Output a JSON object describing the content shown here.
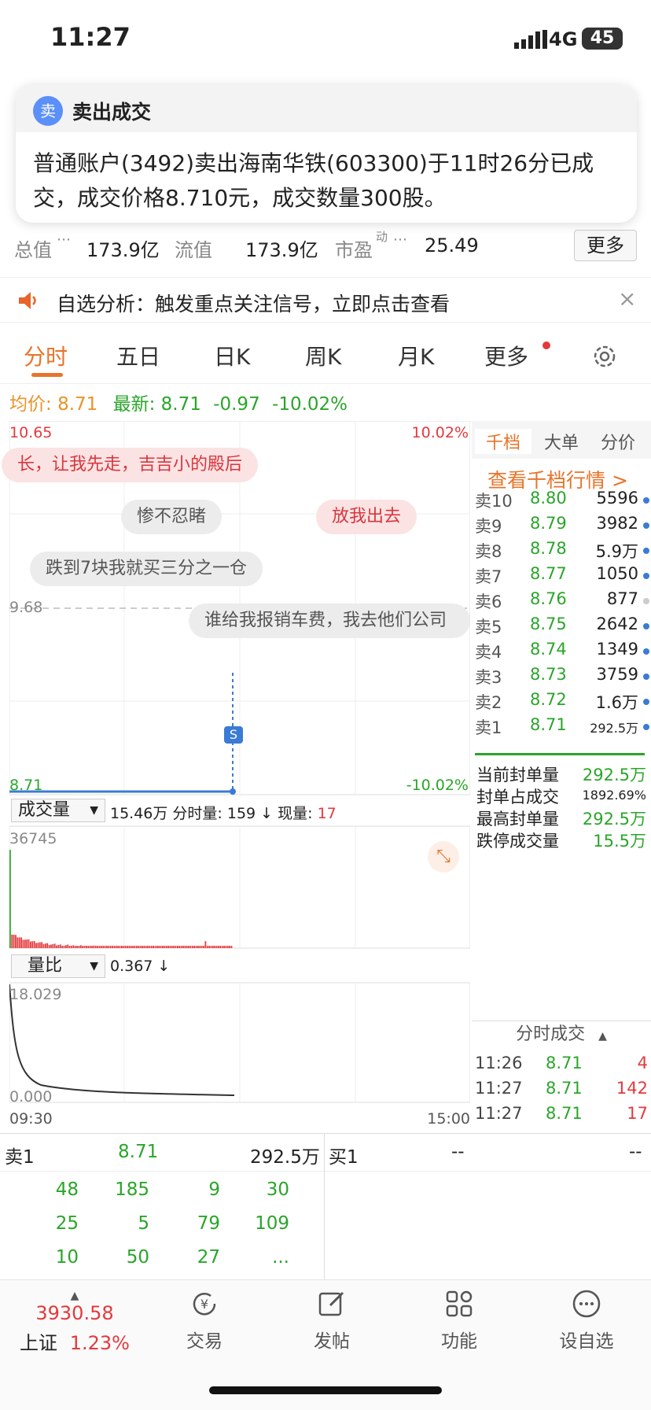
{
  "status_bar": {
    "time": "11:27",
    "network": "4G",
    "battery": "45"
  },
  "notification": {
    "icon_char": "卖",
    "title": "卖出成交",
    "body": "普通账户(3492)卖出海南华铁(603300)于11时26分已成交，成交价格8.710元，成交数量300股。"
  },
  "stats": {
    "total_value_label": "总值",
    "total_value": "173.9亿",
    "float_value_label": "流值",
    "float_value": "173.9亿",
    "pe_label": "市盈",
    "pe_sup": "动",
    "pe_value": "25.49",
    "more_label": "更多"
  },
  "banner": {
    "text": "自选分析：触发重点关注信号，立即点击查看",
    "close": "×"
  },
  "tabs": [
    "分时",
    "五日",
    "日K",
    "周K",
    "月K",
    "更多"
  ],
  "quote_line": {
    "avg_label": "均价:",
    "avg_value": "8.71",
    "latest_label": "最新:",
    "latest_value": "8.71",
    "change": "-0.97",
    "change_pct": "-10.02%"
  },
  "chart": {
    "top_price": "10.65",
    "top_pct": "10.02%",
    "mid_price": "9.68",
    "bottom_price": "8.71",
    "bottom_pct": "-10.02%",
    "marker": "S",
    "bubbles": [
      "长，让我先走，吉吉小的殿后",
      "惨不忍睹",
      "放我出去",
      "跌到7块我就买三分之一仓",
      "谁给我报销车费，我去他们公司"
    ],
    "volume_selector": "成交量",
    "volume_info_a": "15.46万 分时量: 159 ↓ 现量: ",
    "volume_info_now": "17",
    "volume_max": "36745",
    "ratio_selector": "量比",
    "ratio_info": "0.367 ↓",
    "ratio_max": "18.029",
    "ratio_min": "0.000",
    "time_start": "09:30",
    "time_end": "15:00"
  },
  "chart_data": {
    "type": "line",
    "title": "",
    "x": [
      "09:30",
      "15:00"
    ],
    "price_range": [
      8.71,
      10.65
    ],
    "price_series": {
      "values": [
        8.71,
        8.71
      ]
    },
    "volume_max": 36745,
    "volume_ratio_range": [
      0.0,
      18.029
    ],
    "volume_ratio_current": 0.367
  },
  "right_panel": {
    "tabs": [
      "千档",
      "大单",
      "分价"
    ],
    "link": "查看千档行情 >",
    "asks": [
      {
        "label": "卖10",
        "price": "8.80",
        "vol": "5596"
      },
      {
        "label": "卖9",
        "price": "8.79",
        "vol": "3982"
      },
      {
        "label": "卖8",
        "price": "8.78",
        "vol": "5.9万"
      },
      {
        "label": "卖7",
        "price": "8.77",
        "vol": "1050"
      },
      {
        "label": "卖6",
        "price": "8.76",
        "vol": "877"
      },
      {
        "label": "卖5",
        "price": "8.75",
        "vol": "2642"
      },
      {
        "label": "卖4",
        "price": "8.74",
        "vol": "1349"
      },
      {
        "label": "卖3",
        "price": "8.73",
        "vol": "3759"
      },
      {
        "label": "卖2",
        "price": "8.72",
        "vol": "1.6万"
      },
      {
        "label": "卖1",
        "price": "8.71",
        "vol": "292.5万"
      }
    ],
    "seal": [
      {
        "label": "当前封单量",
        "value": "292.5万"
      },
      {
        "label": "封单占成交",
        "value": "1892.69%"
      },
      {
        "label": "最高封单量",
        "value": "292.5万"
      },
      {
        "label": "跌停成交量",
        "value": "15.5万"
      }
    ],
    "ticks_title": "分时成交",
    "ticks": [
      {
        "time": "11:26",
        "price": "8.71",
        "vol": "4"
      },
      {
        "time": "11:27",
        "price": "8.71",
        "vol": "142"
      },
      {
        "time": "11:27",
        "price": "8.71",
        "vol": "17"
      }
    ]
  },
  "book": {
    "sell1_label": "卖1",
    "sell1_price": "8.71",
    "sell1_vol": "292.5万",
    "buy1_label": "买1",
    "buy1_price": "--",
    "buy1_vol": "--",
    "rows": [
      [
        "48",
        "185",
        "9",
        "30"
      ],
      [
        "25",
        "5",
        "79",
        "109"
      ],
      [
        "10",
        "50",
        "27",
        "..."
      ]
    ]
  },
  "nav": {
    "index_value": "3930.58",
    "index_name": "上证",
    "index_pct": "1.23%",
    "items": [
      "交易",
      "发帖",
      "功能",
      "设自选"
    ]
  }
}
